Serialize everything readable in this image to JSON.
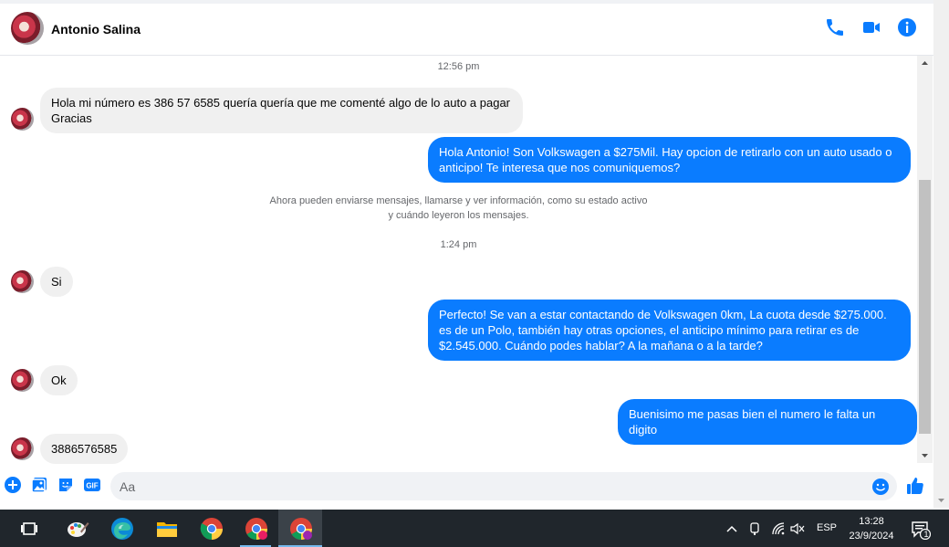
{
  "header": {
    "contact_name": "Antonio Salina"
  },
  "conversation": {
    "timestamp_1": "12:56 pm",
    "msg_1": "Hola mi número es 386 57 6585 quería quería que me comenté algo de lo auto a pagar Gracias",
    "msg_2": "Hola Antonio! Son Volkswagen a $275Mil. Hay opcion de retirarlo con un auto usado o anticipo! Te interesa que nos comuniquemos?",
    "system_line_1": "Ahora pueden enviarse mensajes, llamarse y ver información, como su estado activo",
    "system_line_2": "y cuándo leyeron los mensajes.",
    "timestamp_2": "1:24 pm",
    "msg_3": "Si",
    "msg_4": "Perfecto!  Se van a estar contactando de Volkswagen 0km, La cuota desde $275.000. es de un Polo, también hay otras opciones, el anticipo mínimo para retirar es de $2.545.000. Cuándo podes hablar? A la mañana o a la tarde?",
    "msg_5": "Ok",
    "msg_6": "Buenisimo me pasas bien el numero le falta un digito",
    "msg_7": "3886576585"
  },
  "composer": {
    "placeholder": "Aa"
  },
  "taskbar": {
    "language": "ESP",
    "time": "13:28",
    "date": "23/9/2024",
    "notification_count": "1"
  },
  "colors": {
    "accent": "#0a7cff",
    "incoming_bubble": "#f0f0f0",
    "taskbar": "#20262c"
  }
}
